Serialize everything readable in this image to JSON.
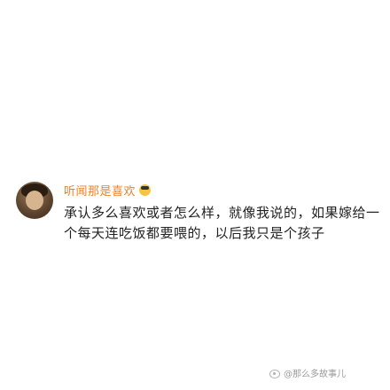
{
  "post": {
    "username": "听闻那是喜欢",
    "username_emoji": "grinning-face-icon",
    "text": "承认多么喜欢或者怎么样，就像我说的，如果嫁给一个每天连吃饭都要喂的，以后我只是个孩子",
    "colors": {
      "username": "#e8822a",
      "text": "#222222"
    }
  },
  "watermark": {
    "text": "@那么多故事儿"
  }
}
